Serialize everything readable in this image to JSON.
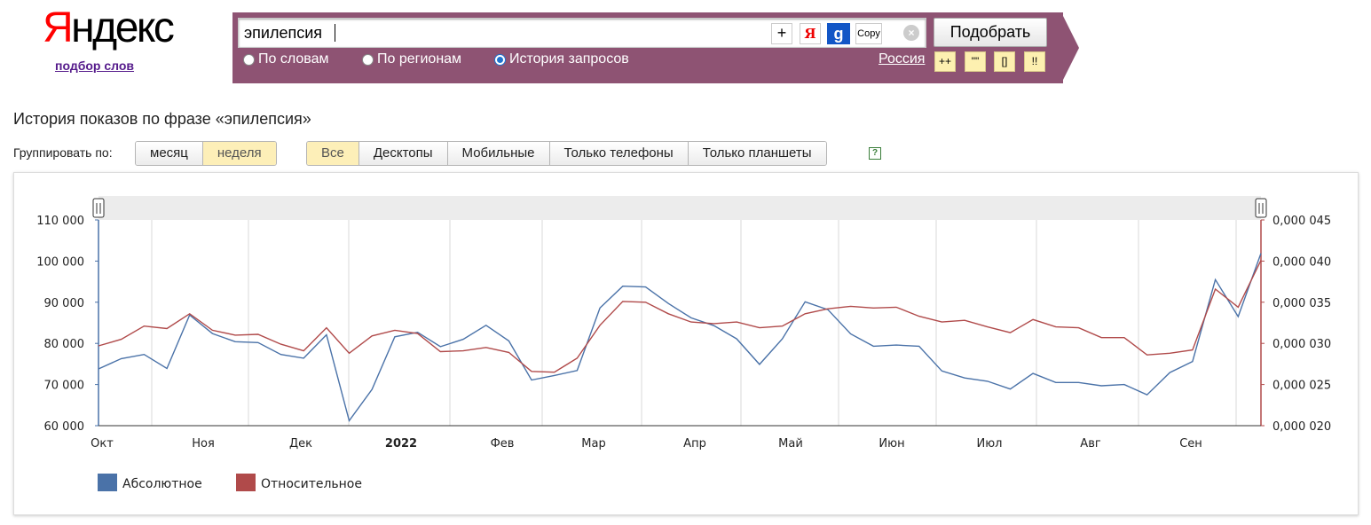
{
  "logo": {
    "first_letter": "Я",
    "rest": "ндекс",
    "sub": "подбор слов"
  },
  "search": {
    "query": "эпилепсия",
    "plus_label": "+",
    "ya_label": "Я",
    "g_label": "g",
    "copy_label": "Copy",
    "clear_label": "×",
    "submit_label": "Подобрать",
    "modes": [
      {
        "label": "По словам",
        "checked": false
      },
      {
        "label": "По регионам",
        "checked": false
      },
      {
        "label": "История запросов",
        "checked": true
      }
    ],
    "region": "Россия",
    "operators": [
      "++",
      "\"\"",
      "[]",
      "!!"
    ]
  },
  "page_title": "История показов по фразе «эпилепсия»",
  "group_by": {
    "label": "Группировать по:",
    "options": [
      "месяц",
      "неделя"
    ],
    "selected": "неделя"
  },
  "device_filter": {
    "options": [
      "Все",
      "Десктопы",
      "Мобильные",
      "Только телефоны",
      "Только планшеты"
    ],
    "selected": "Все"
  },
  "help_label": "?",
  "colors": {
    "abs": "#4a72a8",
    "rel": "#b04a4a",
    "panel": "#8e5373"
  },
  "chart_data": {
    "type": "line",
    "x_ticks": [
      "Окт",
      "Ноя",
      "Дек",
      "2022",
      "Фев",
      "Мар",
      "Апр",
      "Май",
      "Июн",
      "Июл",
      "Авг",
      "Сен"
    ],
    "left_axis": {
      "ticks": [
        "110 000",
        "100 000",
        "90 000",
        "80 000",
        "70 000",
        "60 000"
      ],
      "ylim": [
        60000,
        110000
      ]
    },
    "right_axis": {
      "ticks": [
        "0,000 045",
        "0,000 040",
        "0,000 035",
        "0,000 030",
        "0,000 025",
        "0,000 020"
      ],
      "ylim": [
        2e-05,
        4.5e-05
      ]
    },
    "legend": [
      "Абсолютное",
      "Относительное"
    ],
    "series": [
      {
        "name": "Абсолютное",
        "axis": "left",
        "values": [
          73800,
          76300,
          77300,
          73900,
          86900,
          82400,
          80400,
          80200,
          77300,
          76400,
          82100,
          61200,
          68800,
          81600,
          82700,
          79200,
          81000,
          84400,
          80600,
          71100,
          72200,
          73400,
          88600,
          93900,
          93700,
          89700,
          86200,
          84300,
          81100,
          74900,
          81100,
          90100,
          88200,
          82300,
          79300,
          79600,
          79300,
          73300,
          71600,
          70800,
          68900,
          72700,
          70500,
          70500,
          69700,
          70000,
          67500,
          72900,
          75600,
          95500,
          86500,
          101900
        ]
      },
      {
        "name": "Относительное",
        "axis": "right",
        "values": [
          2.97e-05,
          3.05e-05,
          3.21e-05,
          3.18e-05,
          3.36e-05,
          3.16e-05,
          3.1e-05,
          3.11e-05,
          2.99e-05,
          2.91e-05,
          3.19e-05,
          2.88e-05,
          3.09e-05,
          3.16e-05,
          3.12e-05,
          2.9e-05,
          2.91e-05,
          2.95e-05,
          2.89e-05,
          2.66e-05,
          2.65e-05,
          2.82e-05,
          3.22e-05,
          3.51e-05,
          3.5e-05,
          3.36e-05,
          3.26e-05,
          3.24e-05,
          3.26e-05,
          3.19e-05,
          3.21e-05,
          3.36e-05,
          3.42e-05,
          3.45e-05,
          3.43e-05,
          3.44e-05,
          3.33e-05,
          3.26e-05,
          3.28e-05,
          3.2e-05,
          3.13e-05,
          3.29e-05,
          3.2e-05,
          3.19e-05,
          3.07e-05,
          3.07e-05,
          2.86e-05,
          2.88e-05,
          2.92e-05,
          3.66e-05,
          3.44e-05,
          4.01e-05
        ]
      }
    ]
  }
}
